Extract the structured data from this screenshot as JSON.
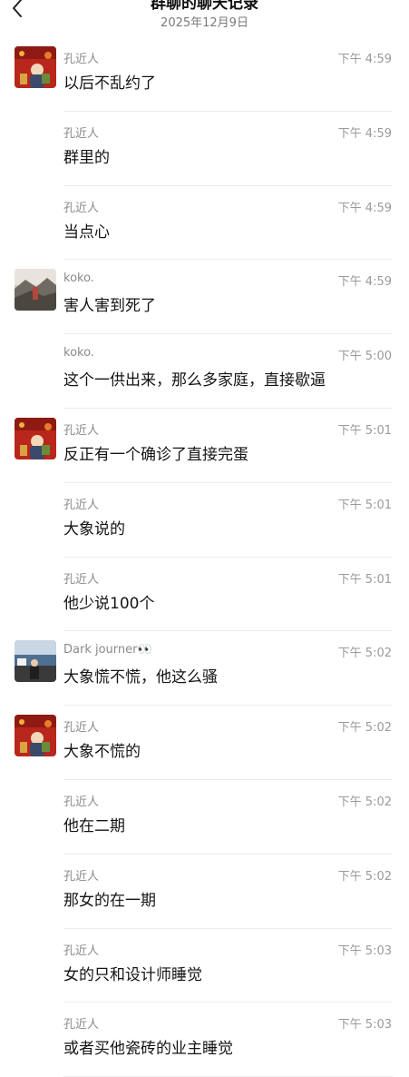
{
  "header": {
    "title": "群聊的聊天记录",
    "date": "2025年12月9日"
  },
  "messages": [
    {
      "sender": "孔近人",
      "time": "下午 4:59",
      "text": "以后不乱约了",
      "avatar": "red-avatar"
    },
    {
      "sender": "孔近人",
      "time": "下午 4:59",
      "text": "群里的",
      "avatar": ""
    },
    {
      "sender": "孔近人",
      "time": "下午 4:59",
      "text": "当点心",
      "avatar": ""
    },
    {
      "sender": "koko.",
      "time": "下午 4:59",
      "text": "害人害到死了",
      "avatar": "landscape-avatar"
    },
    {
      "sender": "koko.",
      "time": "下午 5:00",
      "text": "这个一供出来，那么多家庭，直接歇逼",
      "avatar": ""
    },
    {
      "sender": "孔近人",
      "time": "下午 5:01",
      "text": "反正有一个确诊了直接完蛋",
      "avatar": "red-avatar"
    },
    {
      "sender": "孔近人",
      "time": "下午 5:01",
      "text": "大象说的",
      "avatar": ""
    },
    {
      "sender": "孔近人",
      "time": "下午 5:01",
      "text": "他少说100个",
      "avatar": ""
    },
    {
      "sender": "Dark journer👀",
      "time": "下午 5:02",
      "text": "大象慌不慌，他这么骚",
      "avatar": "photo-avatar"
    },
    {
      "sender": "孔近人",
      "time": "下午 5:02",
      "text": "大象不慌的",
      "avatar": "red-avatar"
    },
    {
      "sender": "孔近人",
      "time": "下午 5:02",
      "text": "他在二期",
      "avatar": ""
    },
    {
      "sender": "孔近人",
      "time": "下午 5:02",
      "text": "那女的在一期",
      "avatar": ""
    },
    {
      "sender": "孔近人",
      "time": "下午 5:03",
      "text": "女的只和设计师睡觉",
      "avatar": ""
    },
    {
      "sender": "孔近人",
      "time": "下午 5:03",
      "text": "或者买他瓷砖的业主睡觉",
      "avatar": ""
    }
  ]
}
